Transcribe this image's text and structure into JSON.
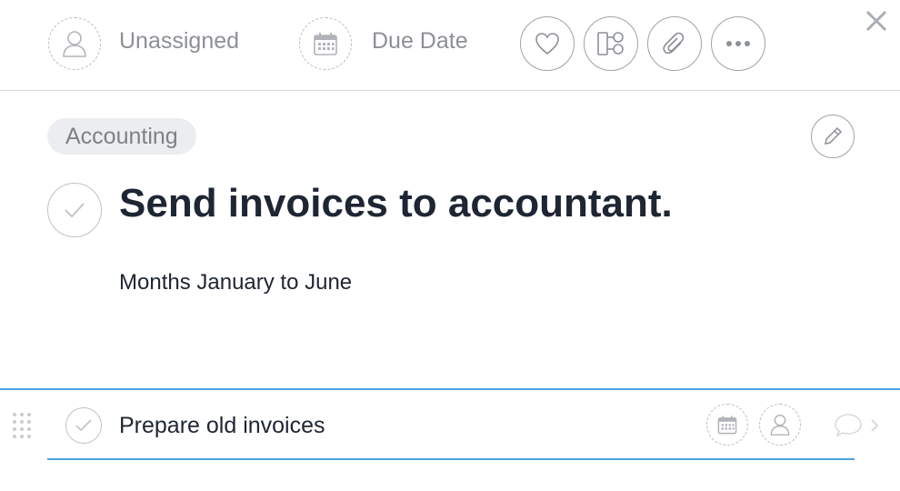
{
  "toolbar": {
    "assignee_label": "Unassigned",
    "due_date_label": "Due Date",
    "icons": [
      "person-icon",
      "calendar-icon",
      "heart-icon",
      "subtasks-icon",
      "paperclip-icon",
      "more-icon",
      "close-icon"
    ]
  },
  "task": {
    "tag": "Accounting",
    "title": "Send invoices to accountant.",
    "description": "Months January to June"
  },
  "subtask": {
    "value": "Prepare old invoices",
    "icons": [
      "drag-handle-icon",
      "checkmark-icon",
      "calendar-icon",
      "person-icon",
      "comment-icon",
      "chevron-right-icon"
    ]
  },
  "colors": {
    "accent": "#4aa3df",
    "title_text": "#1e2533",
    "muted_text": "#8c9096",
    "tag_bg": "#ebedef"
  }
}
